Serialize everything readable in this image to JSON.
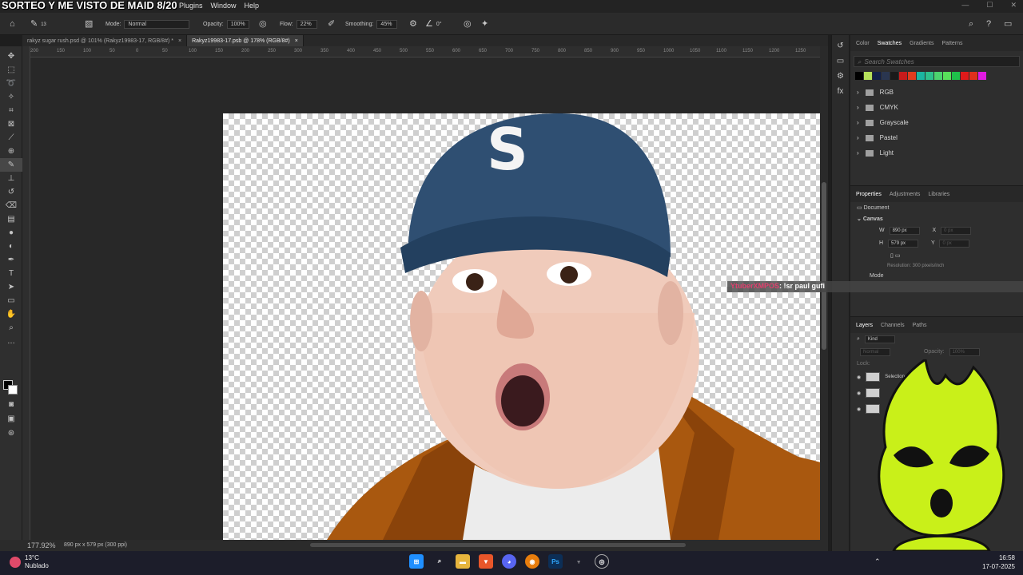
{
  "stream_overlay": {
    "title": "SORTEO Y ME VISTO DE MAID 8/20",
    "chat_user": "YtuberXMPOS",
    "chat_message": ": !sr paul gufi"
  },
  "menubar": {
    "items": [
      "Plugins",
      "Window",
      "Help"
    ]
  },
  "options": {
    "mode_label": "Mode:",
    "mode_value": "Normal",
    "brush_size": "13",
    "opacity_label": "Opacity:",
    "opacity_value": "100%",
    "flow_label": "Flow:",
    "flow_value": "22%",
    "smoothing_label": "Smoothing:",
    "smoothing_value": "45%",
    "angle_value": "0°"
  },
  "tabs": [
    {
      "label": "rakyz sugar rush.psd @ 101% (Rakyz19983-17, RGB/8#) *",
      "active": false
    },
    {
      "label": "Rakyz19983-17.psb @ 178% (RGB/8#)",
      "active": true
    }
  ],
  "ruler": {
    "labels": [
      "200",
      "150",
      "100",
      "50",
      "0",
      "50",
      "100",
      "150",
      "200",
      "250",
      "300",
      "350",
      "400",
      "450",
      "500",
      "550",
      "600",
      "650",
      "700",
      "750",
      "800",
      "850",
      "900",
      "950",
      "1000",
      "1050",
      "1100",
      "1150",
      "1200",
      "1250"
    ]
  },
  "status": {
    "zoom": "177.92%",
    "dims": "890 px x 579 px (300 ppi)"
  },
  "swatches_panel": {
    "tabs": [
      "Color",
      "Swatches",
      "Gradients",
      "Patterns"
    ],
    "active_tab": "Swatches",
    "search_placeholder": "Search Swatches",
    "colors": [
      "#000000",
      "#b5e05a",
      "#12204a",
      "#2a3650",
      "#1a1a1a",
      "#c81b1b",
      "#e03c1e",
      "#1bb5a0",
      "#2ec08c",
      "#4cd36e",
      "#58e05a",
      "#1fc04a",
      "#e01a1a",
      "#e0301a",
      "#e01ae0"
    ],
    "folders": [
      "RGB",
      "CMYK",
      "Grayscale",
      "Pastel",
      "Light"
    ]
  },
  "properties_panel": {
    "tabs": [
      "Properties",
      "Adjustments",
      "Libraries"
    ],
    "active_tab": "Properties",
    "document_label": "Document",
    "canvas_label": "Canvas",
    "width_label": "W",
    "width_value": "890 px",
    "height_label": "H",
    "height_value": "579 px",
    "x_label": "X",
    "x_value": "0 px",
    "y_label": "Y",
    "y_value": "0 px",
    "resolution": "Resolution: 300 pixels/inch",
    "mode_label": "Mode"
  },
  "layers_panel": {
    "tabs": [
      "Layers",
      "Channels",
      "Paths"
    ],
    "active_tab": "Layers",
    "filter_label": "Kind",
    "blend_mode": "Normal",
    "opacity_label": "Opacity:",
    "opacity_value": "100%",
    "lock_label": "Lock:",
    "layers": [
      {
        "name": "Selection 1"
      },
      {
        "name": ""
      },
      {
        "name": ""
      }
    ]
  },
  "taskbar": {
    "temperature": "13°C",
    "weather": "Nublado",
    "time": "16:58",
    "date": "17-07-2025",
    "apps": [
      "windows",
      "search",
      "files",
      "brave",
      "discord",
      "blender",
      "photoshop",
      "app1",
      "obs"
    ]
  }
}
